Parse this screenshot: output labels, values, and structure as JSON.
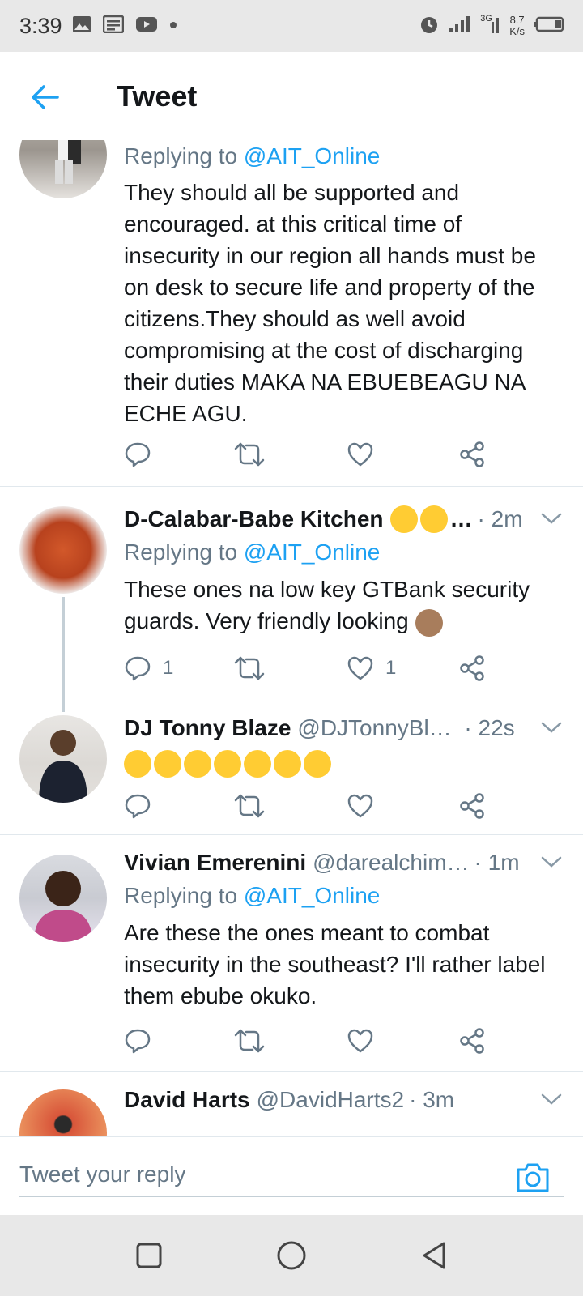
{
  "status_bar": {
    "time": "3:39",
    "network_type": "3G",
    "speed_value": "8.7",
    "speed_unit": "K/s",
    "icons": [
      "image-icon",
      "news-icon",
      "youtube-icon",
      "dot-icon",
      "alarm-icon",
      "signal-icon",
      "signal-3g-icon",
      "battery-icon"
    ]
  },
  "header": {
    "title": "Tweet",
    "back_icon": "arrow-left-icon"
  },
  "colors": {
    "accent": "#1da1f2",
    "text_primary": "#14171a",
    "text_secondary": "#657786",
    "divider": "#e1e8ed",
    "system_bar": "#e8e8e8"
  },
  "tweets": [
    {
      "name": "",
      "handle": "",
      "time": "",
      "replying_prefix": "Replying to ",
      "replying_to": "@AIT_Online",
      "body": "They should all be supported and encouraged. at this critical time of insecurity in our region all hands must be on desk to secure life and property of the citizens.They should as well avoid compromising at the cost of discharging their duties MAKA NA EBUEBEAGU NA ECHE AGU.",
      "replies": "",
      "likes": ""
    },
    {
      "name": "D-Calabar-Babe Kitchen",
      "name_suffix": "…",
      "handle": "",
      "time": "· 2m",
      "replying_prefix": "Replying to ",
      "replying_to": "@AIT_Online",
      "body": "These ones na low key GTBank security guards. Very friendly looking",
      "replies": "1",
      "likes": "1"
    },
    {
      "name": "DJ Tonny Blaze",
      "handle": "@DJTonnyBla…",
      "time": "· 22s",
      "body_emoji_count": 7,
      "replies": "",
      "likes": ""
    },
    {
      "name": "Vivian Emerenini",
      "handle": "@darealchim…",
      "time": "· 1m",
      "replying_prefix": "Replying to ",
      "replying_to": "@AIT_Online",
      "body": "Are these the ones meant to combat insecurity in the southeast? I'll rather label them ebube okuko.",
      "replies": "",
      "likes": ""
    },
    {
      "name": "David Harts",
      "handle": "@DavidHarts2",
      "time": "· 3m"
    }
  ],
  "reply_bar": {
    "placeholder": "Tweet your reply",
    "camera_icon": "camera-icon"
  },
  "nav_bar": {
    "icons": [
      "recents-square-icon",
      "home-circle-icon",
      "back-triangle-icon"
    ]
  }
}
